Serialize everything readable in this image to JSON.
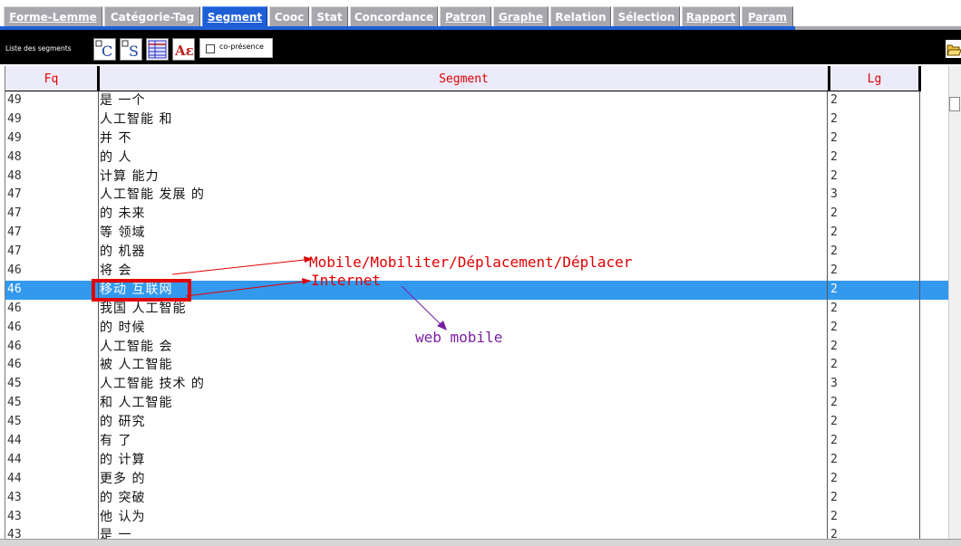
{
  "tabs": [
    {
      "label": "Forme-Lemme"
    },
    {
      "label": "Catégorie-Tag"
    },
    {
      "label": "Segment",
      "active": true
    },
    {
      "label": "Cooc"
    },
    {
      "label": "Stat"
    },
    {
      "label": "Concordance"
    },
    {
      "label": "Patron"
    },
    {
      "label": "Graphe"
    },
    {
      "label": "Relation"
    },
    {
      "label": "Sélection"
    },
    {
      "label": "Rapport"
    },
    {
      "label": "Param"
    }
  ],
  "toolbar": {
    "title": "Liste des segments",
    "checkbox_label": "co-présence",
    "checkbox_checked": false,
    "buttons": [
      "C",
      "S",
      "",
      "Aɛ"
    ]
  },
  "table": {
    "headers": {
      "fq": "Fq",
      "segment": "Segment",
      "lg": "Lg"
    },
    "rows": [
      {
        "fq": "49",
        "segment": "是 一个",
        "lg": "2"
      },
      {
        "fq": "49",
        "segment": "人工智能 和",
        "lg": "2"
      },
      {
        "fq": "49",
        "segment": "并 不",
        "lg": "2"
      },
      {
        "fq": "48",
        "segment": "的 人",
        "lg": "2"
      },
      {
        "fq": "48",
        "segment": "计算 能力",
        "lg": "2"
      },
      {
        "fq": "47",
        "segment": "人工智能 发展 的",
        "lg": "3"
      },
      {
        "fq": "47",
        "segment": "的 未来",
        "lg": "2"
      },
      {
        "fq": "47",
        "segment": "等 领域",
        "lg": "2"
      },
      {
        "fq": "47",
        "segment": "的 机器",
        "lg": "2"
      },
      {
        "fq": "46",
        "segment": "将 会",
        "lg": "2"
      },
      {
        "fq": "46",
        "segment": "移动 互联网",
        "lg": "2",
        "selected": true
      },
      {
        "fq": "46",
        "segment": "我国 人工智能",
        "lg": "2"
      },
      {
        "fq": "46",
        "segment": "的 时候",
        "lg": "2"
      },
      {
        "fq": "46",
        "segment": "人工智能 会",
        "lg": "2"
      },
      {
        "fq": "46",
        "segment": "被 人工智能",
        "lg": "2"
      },
      {
        "fq": "45",
        "segment": "人工智能 技术 的",
        "lg": "3"
      },
      {
        "fq": "45",
        "segment": "和 人工智能",
        "lg": "2"
      },
      {
        "fq": "45",
        "segment": "的 研究",
        "lg": "2"
      },
      {
        "fq": "44",
        "segment": "有 了",
        "lg": "2"
      },
      {
        "fq": "44",
        "segment": "的 计算",
        "lg": "2"
      },
      {
        "fq": "44",
        "segment": "更多 的",
        "lg": "2"
      },
      {
        "fq": "43",
        "segment": "的 突破",
        "lg": "2"
      },
      {
        "fq": "43",
        "segment": "他 认为",
        "lg": "2"
      },
      {
        "fq": "43",
        "segment": "是 一",
        "lg": "2"
      }
    ]
  },
  "annotations": {
    "translation_1": "Mobile/Mobiliter/Déplacement/Déplacer",
    "translation_2": "Internet",
    "note": "web mobile"
  },
  "colors": {
    "tab_bg": "#a7a7ad",
    "tab_active": "#1f5fd6",
    "header_text": "#e00000",
    "header_bg": "#ebebfa",
    "selected_row": "#3399ee",
    "annotation_red": "#e00000",
    "annotation_purple": "#7a1fa0"
  }
}
